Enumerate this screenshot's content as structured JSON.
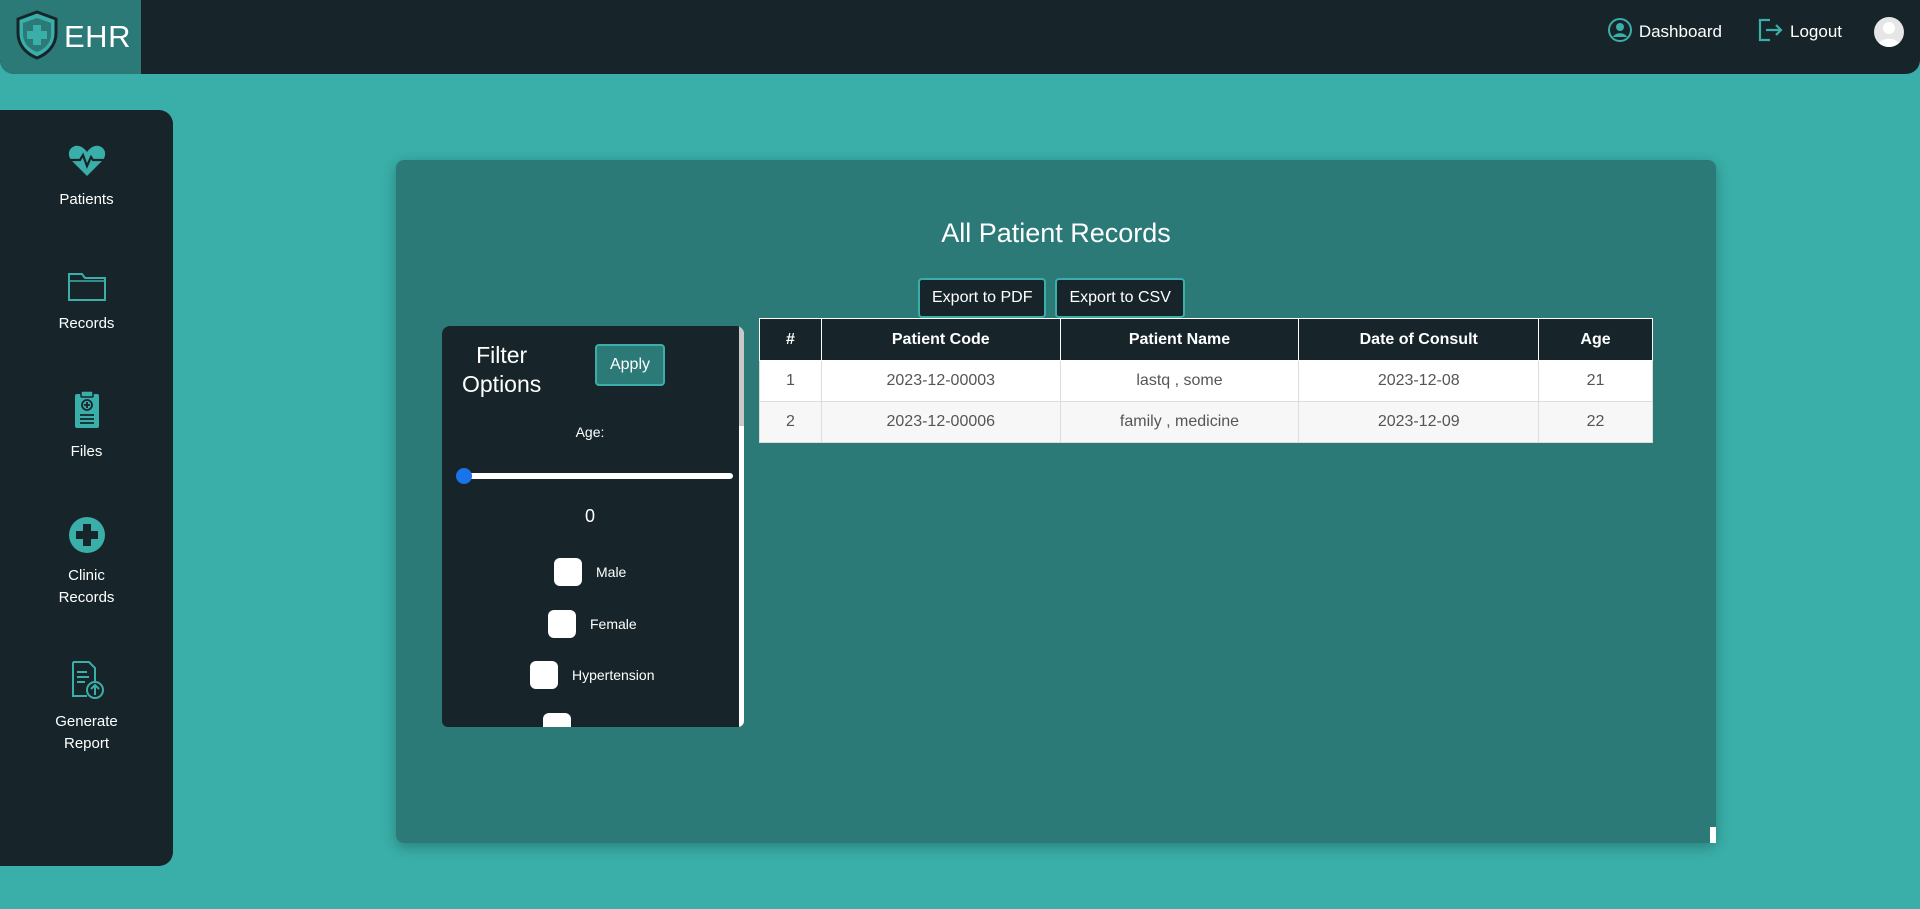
{
  "header": {
    "brand": "EHR",
    "dashboard_label": "Dashboard",
    "logout_label": "Logout"
  },
  "sidebar": {
    "items": [
      {
        "label": "Patients",
        "icon": "heartbeat-icon"
      },
      {
        "label": "Records",
        "icon": "folder-icon"
      },
      {
        "label": "Files",
        "icon": "clipboard-icon"
      },
      {
        "label_line1": "Clinic",
        "label_line2": "Records",
        "icon": "medical-cross-icon"
      },
      {
        "label_line1": "Generate",
        "label_line2": "Report",
        "icon": "report-upload-icon"
      }
    ]
  },
  "main": {
    "title": "All Patient Records",
    "export_pdf": "Export to PDF",
    "export_csv": "Export to CSV"
  },
  "filter": {
    "title_line1": "Filter",
    "title_line2": "Options",
    "apply": "Apply",
    "age_label": "Age:",
    "age_value": "0",
    "age_fraction": 0,
    "options": [
      "Male",
      "Female",
      "Hypertension"
    ]
  },
  "table": {
    "headers": [
      "#",
      "Patient Code",
      "Patient Name",
      "Date of Consult",
      "Age"
    ],
    "rows": [
      [
        "1",
        "2023-12-00003",
        "lastq , some",
        "2023-12-08",
        "21"
      ],
      [
        "2",
        "2023-12-00006",
        "family , medicine",
        "2023-12-09",
        "22"
      ]
    ]
  },
  "colors": {
    "background": "#3aafa9",
    "dark": "#17252a",
    "card": "#2b7a78",
    "slider": "#1a73e8"
  }
}
